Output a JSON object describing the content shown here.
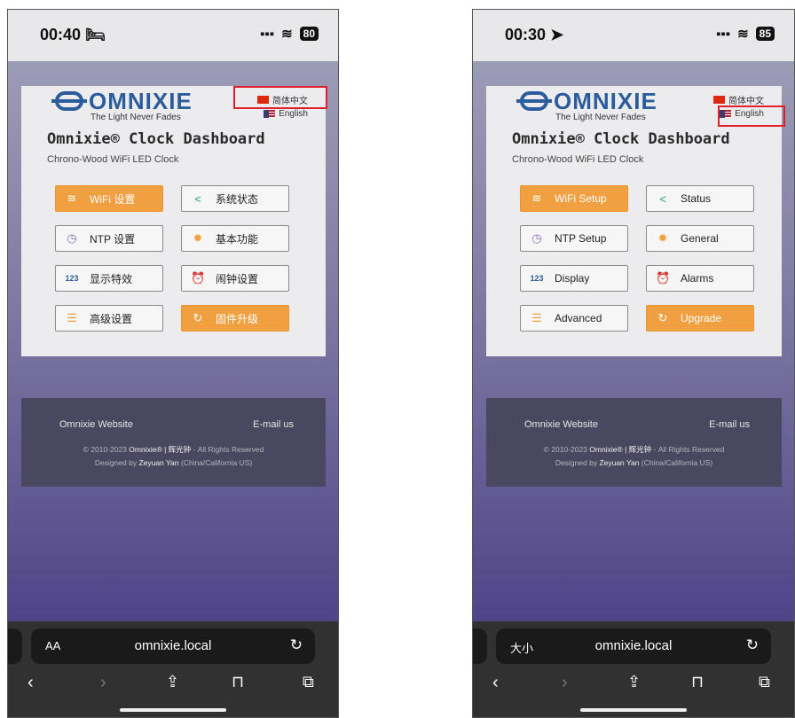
{
  "screens": [
    {
      "status": {
        "time": "00:40",
        "time_icon": "🛏",
        "signal": "▪▪▪",
        "wifi": "≋",
        "battery": "80"
      },
      "languages": {
        "cn": "简体中文",
        "en": "English"
      },
      "logo": {
        "text": "OMNIXIE",
        "tagline": "The Light Never Fades"
      },
      "title": "Omnixie® Clock Dashboard",
      "subtitle": "Chrono-Wood WiFi LED Clock",
      "buttons": [
        "WiFi 设置",
        "系统状态",
        "NTP 设置",
        "基本功能",
        "显示特效",
        "闹钟设置",
        "高级设置",
        "固件升级"
      ],
      "footer": {
        "website": "Omnixie Website",
        "email": "E-mail us",
        "copyright_prefix": "© 2010-2023 ",
        "copyright_brand": "Omnixie® | 辉光钟",
        "copyright_suffix": " - All Rights Reserved",
        "designed_prefix": "Designed by ",
        "designer": "Zeyuan Yan",
        "designed_suffix": " (China/California US)"
      },
      "browser": {
        "aa": "AA",
        "url": "omnixie.local",
        "reload": "↻"
      }
    },
    {
      "status": {
        "time": "00:30",
        "time_icon": "➤",
        "signal": "▪▪▪",
        "wifi": "≋",
        "battery": "85"
      },
      "languages": {
        "cn": "简体中文",
        "en": "English"
      },
      "logo": {
        "text": "OMNIXIE",
        "tagline": "The Light Never Fades"
      },
      "title": "Omnixie® Clock Dashboard",
      "subtitle": "Chrono-Wood WiFi LED Clock",
      "buttons": [
        "WiFi Setup",
        "Status",
        "NTP Setup",
        "General",
        "Display",
        "Alarms",
        "Advanced",
        "Upgrade"
      ],
      "footer": {
        "website": "Omnixie Website",
        "email": "E-mail us",
        "copyright_prefix": "© 2010-2023 ",
        "copyright_brand": "Omnixie® | 辉光钟",
        "copyright_suffix": " - All Rights Reserved",
        "designed_prefix": "Designed by ",
        "designer": "Zeyuan Yan",
        "designed_suffix": " (China/California US)"
      },
      "browser": {
        "aa": "大小",
        "url": "omnixie.local",
        "reload": "↻"
      }
    }
  ],
  "icons": {
    "wifi": "wifi-icon",
    "share": "share-icon",
    "clock": "clock-icon",
    "gear": "gear-icon",
    "numbers": "numbers-icon",
    "alarm": "alarm-icon",
    "menu": "menu-icon",
    "refresh": "refresh-icon"
  },
  "colors": {
    "accent": "#f0a040",
    "brand": "#2b5d9c",
    "highlight": "#e0202a",
    "footer_bg": "#4a4760"
  }
}
